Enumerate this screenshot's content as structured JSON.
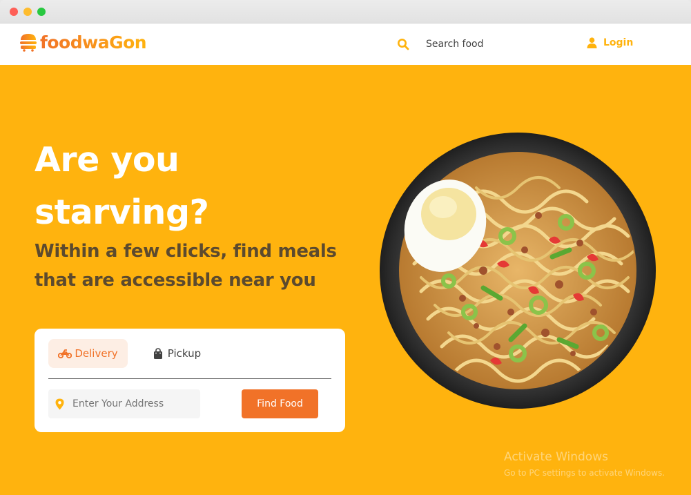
{
  "window": {
    "controls": [
      "close",
      "minimize",
      "maximize"
    ]
  },
  "navbar": {
    "brand": "foodwaGon",
    "brand_icon": "burger-icon",
    "search": {
      "icon": "search-icon",
      "placeholder": "Search food"
    },
    "login": {
      "icon": "user-icon",
      "label": "Login"
    }
  },
  "hero": {
    "title": "Are you starving?",
    "subtitle": "Within a few clicks, find meals that are accessible near you",
    "image": "ramen-bowl"
  },
  "search_card": {
    "tabs": [
      {
        "label": "Delivery",
        "icon": "motorbike-icon",
        "active": true
      },
      {
        "label": "Pickup",
        "icon": "shopping-bag-icon",
        "active": false
      }
    ],
    "address": {
      "icon": "location-pin-icon",
      "placeholder": "Enter Your Address"
    },
    "submit_label": "Find Food"
  },
  "watermark": {
    "title": "Activate Windows",
    "subtitle": "Go to PC settings to activate Windows."
  },
  "colors": {
    "primary": "#ffb30e",
    "accent": "#f17228",
    "subtitle": "#5c4a2e",
    "tab_active_bg": "#fdeee4"
  }
}
